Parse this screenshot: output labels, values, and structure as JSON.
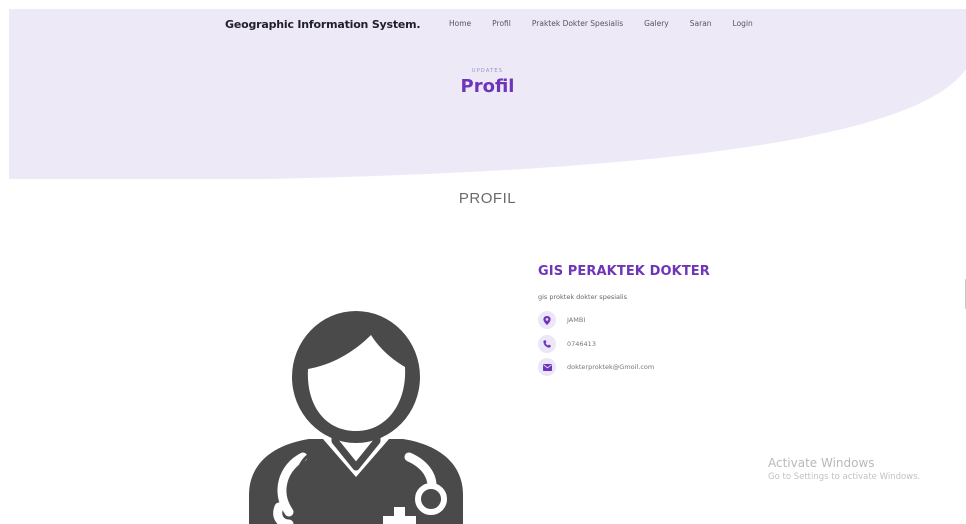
{
  "nav": {
    "brand": "Geographic Information System.",
    "links": [
      {
        "label": "Home"
      },
      {
        "label": "Profil"
      },
      {
        "label": "Praktek Dokter Spesialis"
      },
      {
        "label": "Galery"
      },
      {
        "label": "Saran"
      },
      {
        "label": "Login"
      }
    ]
  },
  "hero": {
    "eyebrow": "UPDATES",
    "title": "Profil"
  },
  "section": {
    "title": "PROFIL"
  },
  "profile": {
    "name": "GIS PERAKTEK DOKTER",
    "description": "gis proktek dokter spesialis",
    "contacts": [
      {
        "icon": "location-pin-icon",
        "text": "JAMBI"
      },
      {
        "icon": "phone-icon",
        "text": "0746413"
      },
      {
        "icon": "envelope-icon",
        "text": "dokterproktek@Gmoil.com"
      }
    ]
  },
  "watermark": {
    "title": "Activate Windows",
    "subtitle": "Go to Settings to activate Windows."
  },
  "colors": {
    "accent": "#6f35b8",
    "hero_bg": "#ede9f7",
    "icon_bg": "#ebe6f8",
    "doctor": "#4a4a4a"
  }
}
